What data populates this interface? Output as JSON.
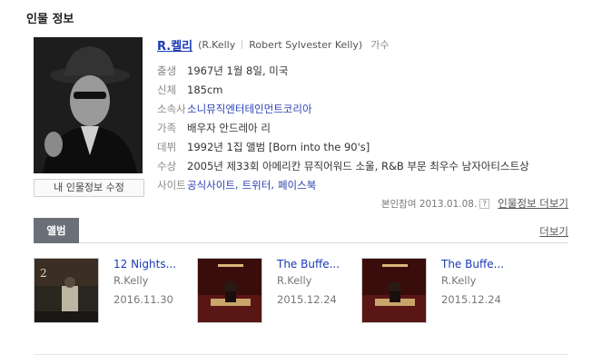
{
  "section_title": "인물 정보",
  "person": {
    "name": "R.켈리",
    "alias": "(R.Kelly",
    "full_name": "Robert Sylvester Kelly)",
    "role": "가수",
    "edit_button": "내 인물정보 수정"
  },
  "info": {
    "birth_label": "출생",
    "birth_value": "1967년 1월 8일, 미국",
    "body_label": "신체",
    "body_value": "185cm",
    "agency_label": "소속사",
    "agency_value": "소니뮤직엔터테인먼트코리아",
    "family_label": "가족",
    "family_value": "배우자 안드레아 리",
    "debut_label": "데뷔",
    "debut_value": "1992년 1집 앨범 [Born into the 90's]",
    "award_label": "수상",
    "award_value": "2005년 제33회 아메리칸 뮤직어워드 소울, R&B 부문 최우수 남자아티스트상",
    "site_label": "사이트",
    "sites": [
      "공식사이트",
      "트위터",
      "페이스북"
    ]
  },
  "reference": {
    "text": "본인참여 2013.01.08.",
    "help_icon": "?",
    "more_link": "인물정보 더보기"
  },
  "albums_section": {
    "tab_label": "앨범",
    "more_label": "더보기",
    "items": [
      {
        "title": "12 Nights...",
        "artist": "R.Kelly",
        "date": "2016.11.30"
      },
      {
        "title": "The Buffe...",
        "artist": "R.Kelly",
        "date": "2015.12.24"
      },
      {
        "title": "The Buffe...",
        "artist": "R.Kelly",
        "date": "2015.12.24"
      }
    ]
  },
  "icons": {
    "help": "question-icon"
  }
}
